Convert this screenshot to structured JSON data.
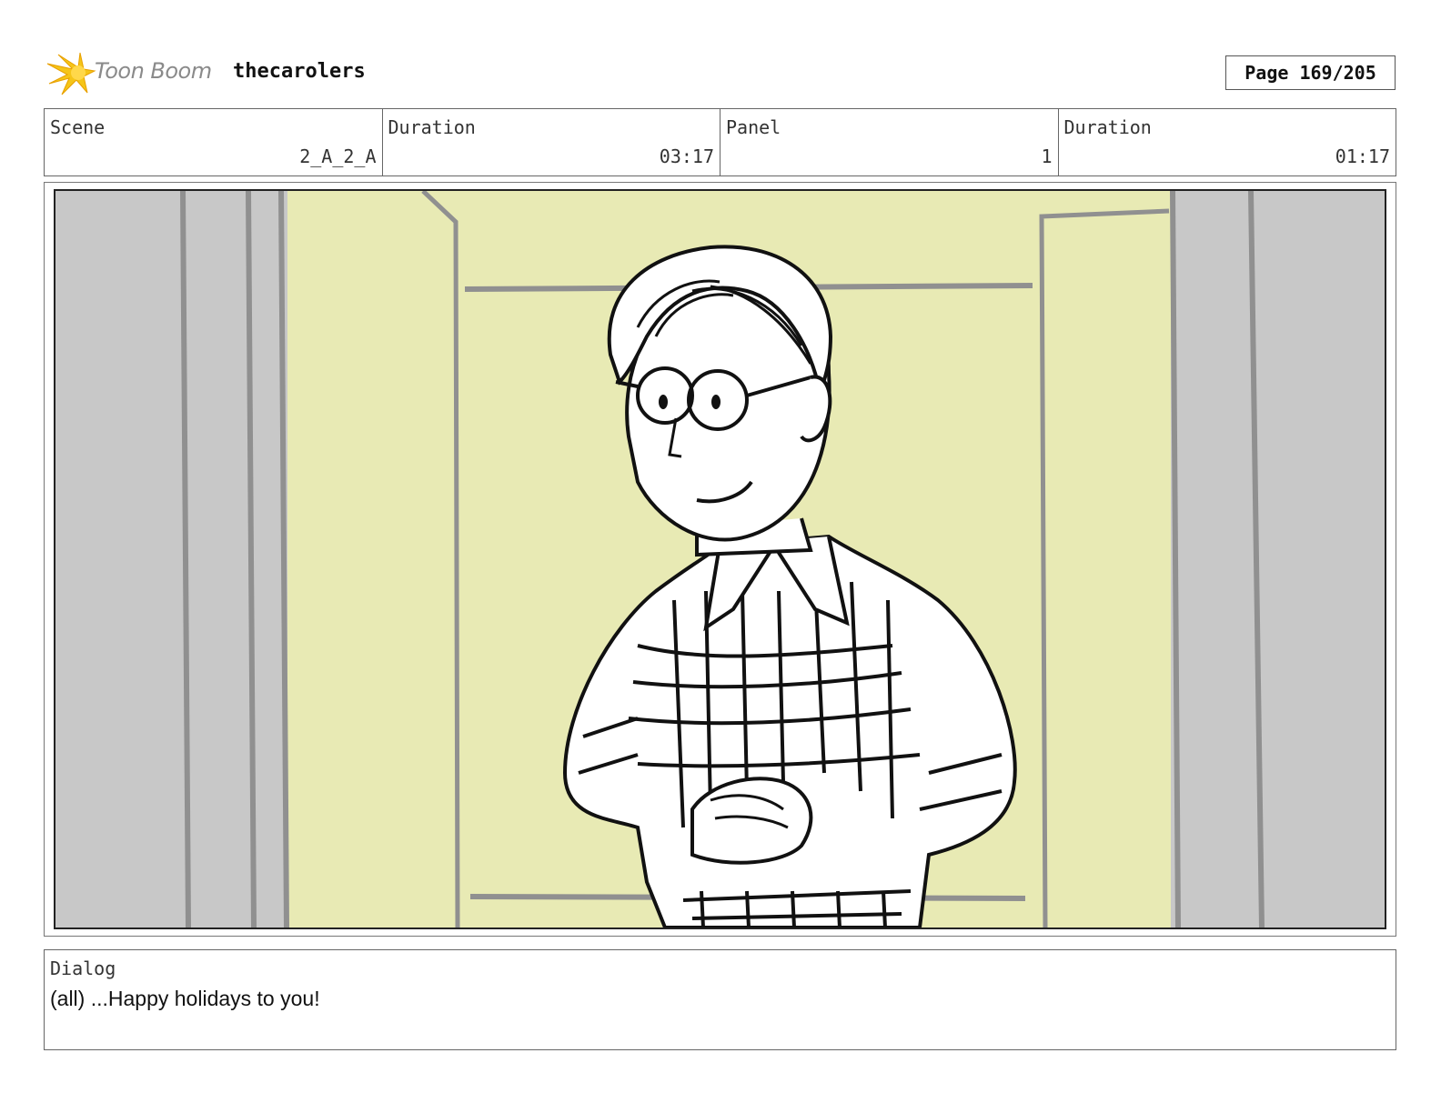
{
  "header": {
    "logo_text": "Toon Boom",
    "project": "thecarolers",
    "page": "Page 169/205"
  },
  "info": {
    "scene_label": "Scene",
    "scene_value": "2_A_2_A",
    "scene_duration_label": "Duration",
    "scene_duration_value": "03:17",
    "panel_label": "Panel",
    "panel_value": "1",
    "panel_duration_label": "Duration",
    "panel_duration_value": "01:17"
  },
  "dialog": {
    "label": "Dialog",
    "text": "(all) ...Happy holidays to you!"
  },
  "colors": {
    "background_wall": "#e8eab4",
    "side_panels": "#c8c8c8",
    "line_art": "#111111",
    "logo_star": "#f5c518"
  }
}
